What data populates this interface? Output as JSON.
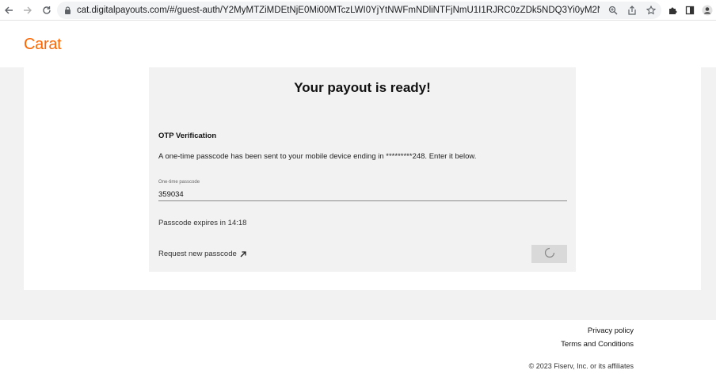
{
  "browser": {
    "url": "cat.digitalpayouts.com/#/guest-auth/Y2MyMTZiMDEtNjE0Mi00MTczLWI0YjYtNWFmNDliNTFjNmU1I1RJRC0zZDk5NDQ3Yi0yM2NhLTQ1Y2ItOWJ...",
    "icons": [
      "back-icon",
      "forward-icon",
      "reload-icon",
      "lock-icon",
      "zoom-icon",
      "share-icon",
      "star-icon",
      "extensions-icon",
      "side-panel-icon",
      "profile-icon"
    ]
  },
  "header": {
    "logo": "Carat",
    "logo_color": "#ff6600"
  },
  "card": {
    "title": "Your payout is ready!",
    "otp_heading": "OTP Verification",
    "description": "A one-time passcode has been sent to your mobile device ending in *********248. Enter it below.",
    "field_label": "One-time passcode",
    "field_value": "359034",
    "expires": "Passcode expires in 14:18",
    "request_link": "Request new passcode",
    "submit_state": "loading"
  },
  "footer": {
    "privacy": "Privacy policy",
    "terms": "Terms and Conditions",
    "copyright": "© 2023 Fiserv, Inc. or its affiliates"
  }
}
